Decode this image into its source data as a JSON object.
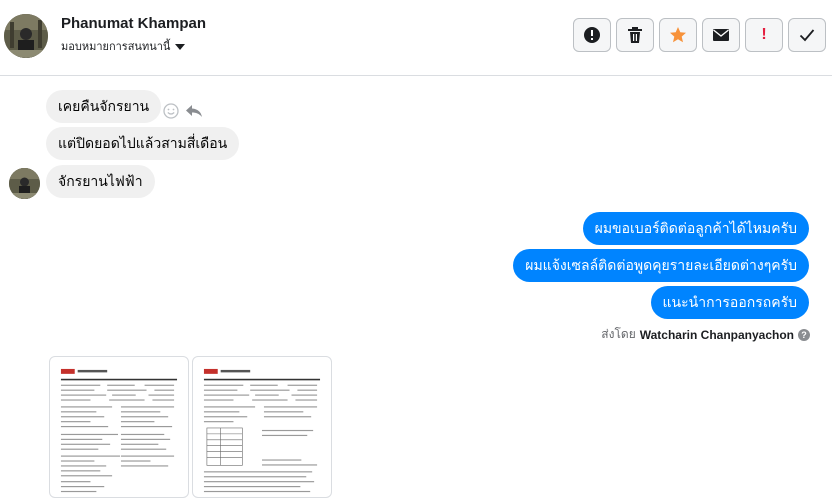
{
  "header": {
    "contact_name": "Phanumat Khampan",
    "assign_label": "มอบหมายการสนทนานี้",
    "actions": [
      {
        "name": "alert-circle-icon",
        "label": ""
      },
      {
        "name": "trash-icon",
        "label": ""
      },
      {
        "name": "star-icon",
        "label": ""
      },
      {
        "name": "envelope-icon",
        "label": ""
      },
      {
        "name": "exclamation-icon",
        "label": "!"
      },
      {
        "name": "check-icon",
        "label": ""
      }
    ]
  },
  "messages": {
    "incoming": [
      "เคยคืนจักรยาน",
      "แต่ปิดยอดไปแล้วสามสี่เดือน",
      "จักรยานไฟฟ้า"
    ],
    "outgoing": [
      "ผมขอเบอร์ติดต่อลูกค้าได้ไหมครับ",
      "ผมแจ้งเซลล์ติดต่อพูดคุยรายละเอียดต่างๆครับ",
      "แนะนำการออกรถครับ"
    ]
  },
  "sent_by": {
    "prefix": "ส่งโดย",
    "name": "Watcharin Chanpanyachon",
    "help": "?"
  },
  "colors": {
    "outgoing_bubble": "#0084ff",
    "incoming_bubble": "#f0f0f0",
    "star": "#f7923a",
    "exclamation": "#e41e3f"
  }
}
